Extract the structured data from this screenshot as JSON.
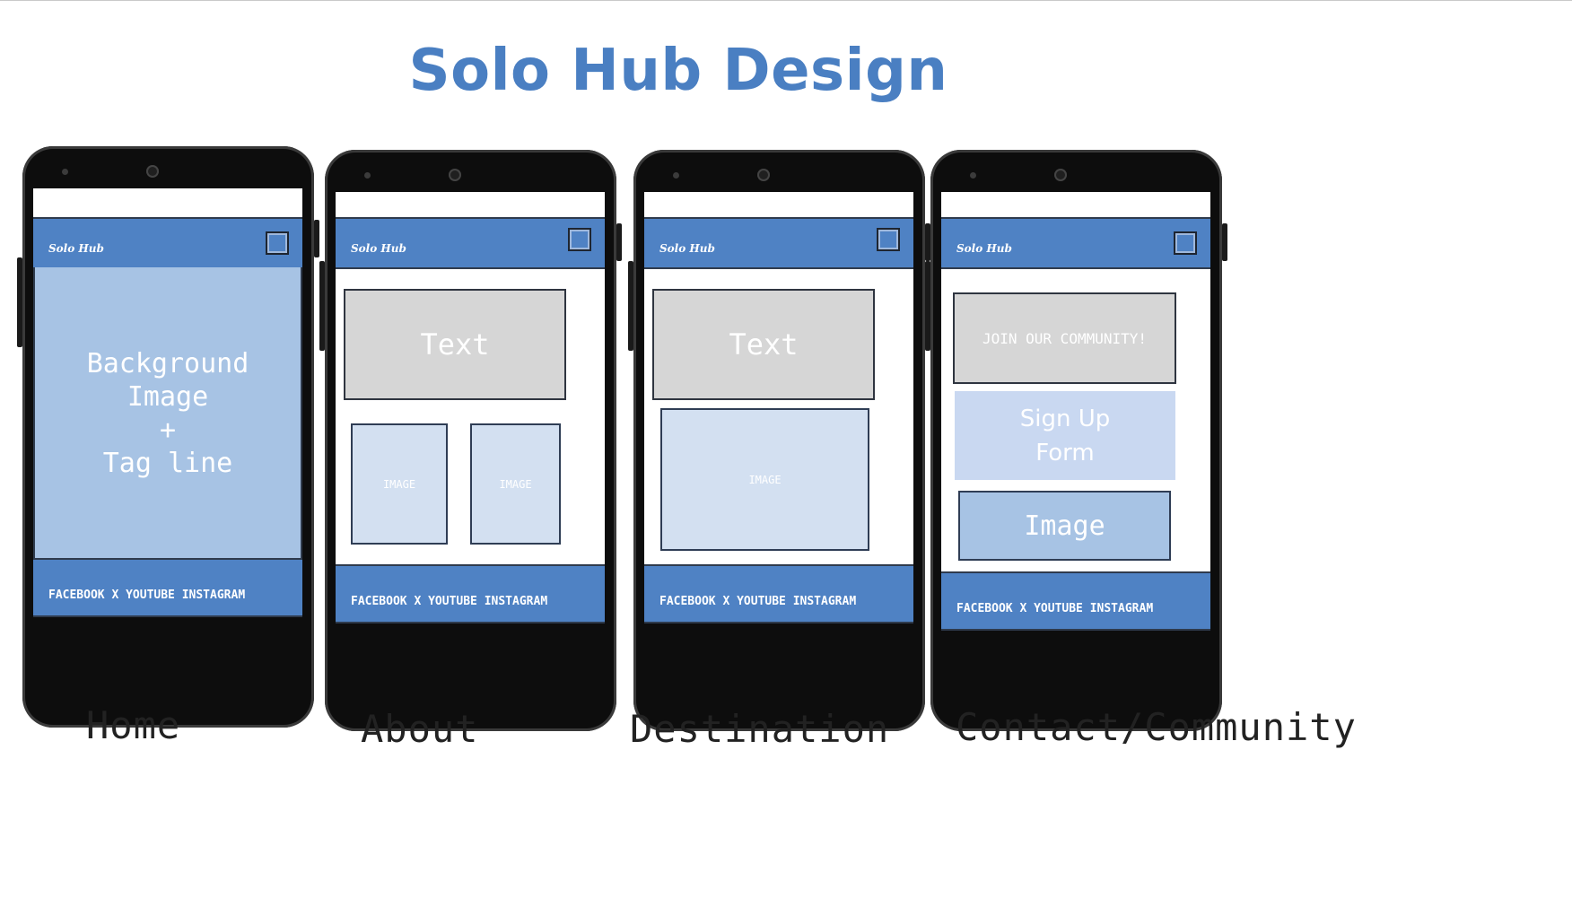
{
  "title": "Solo Hub Design",
  "brand_color": "#4a7fc2",
  "header_color": "#4f82c4",
  "phones": {
    "home": {
      "logo": "Solo Hub",
      "hero": {
        "line1": "Background",
        "line2": "Image",
        "line3": "+",
        "line4": "Tag line"
      },
      "footer": "FACEBOOK X YOUTUBE INSTAGRAM",
      "caption": "Home"
    },
    "about": {
      "logo": "Solo Hub",
      "text_block": "Text",
      "image_left": "IMAGE",
      "image_right": "IMAGE",
      "footer": "FACEBOOK X YOUTUBE INSTAGRAM",
      "caption": "About"
    },
    "destination": {
      "logo": "Solo Hub",
      "text_block": "Text",
      "image": "IMAGE",
      "footer": "FACEBOOK X YOUTUBE INSTAGRAM",
      "caption": "Destination"
    },
    "contact": {
      "logo": "Solo Hub",
      "join": "JOIN OUR COMMUNITY!",
      "signup_line1": "Sign Up",
      "signup_line2": "Form",
      "image": "Image",
      "footer": "FACEBOOK X YOUTUBE INSTAGRAM",
      "caption": "Contact/Community"
    }
  },
  "icons": {
    "menu": "square-menu-icon",
    "camera": "camera-icon"
  }
}
